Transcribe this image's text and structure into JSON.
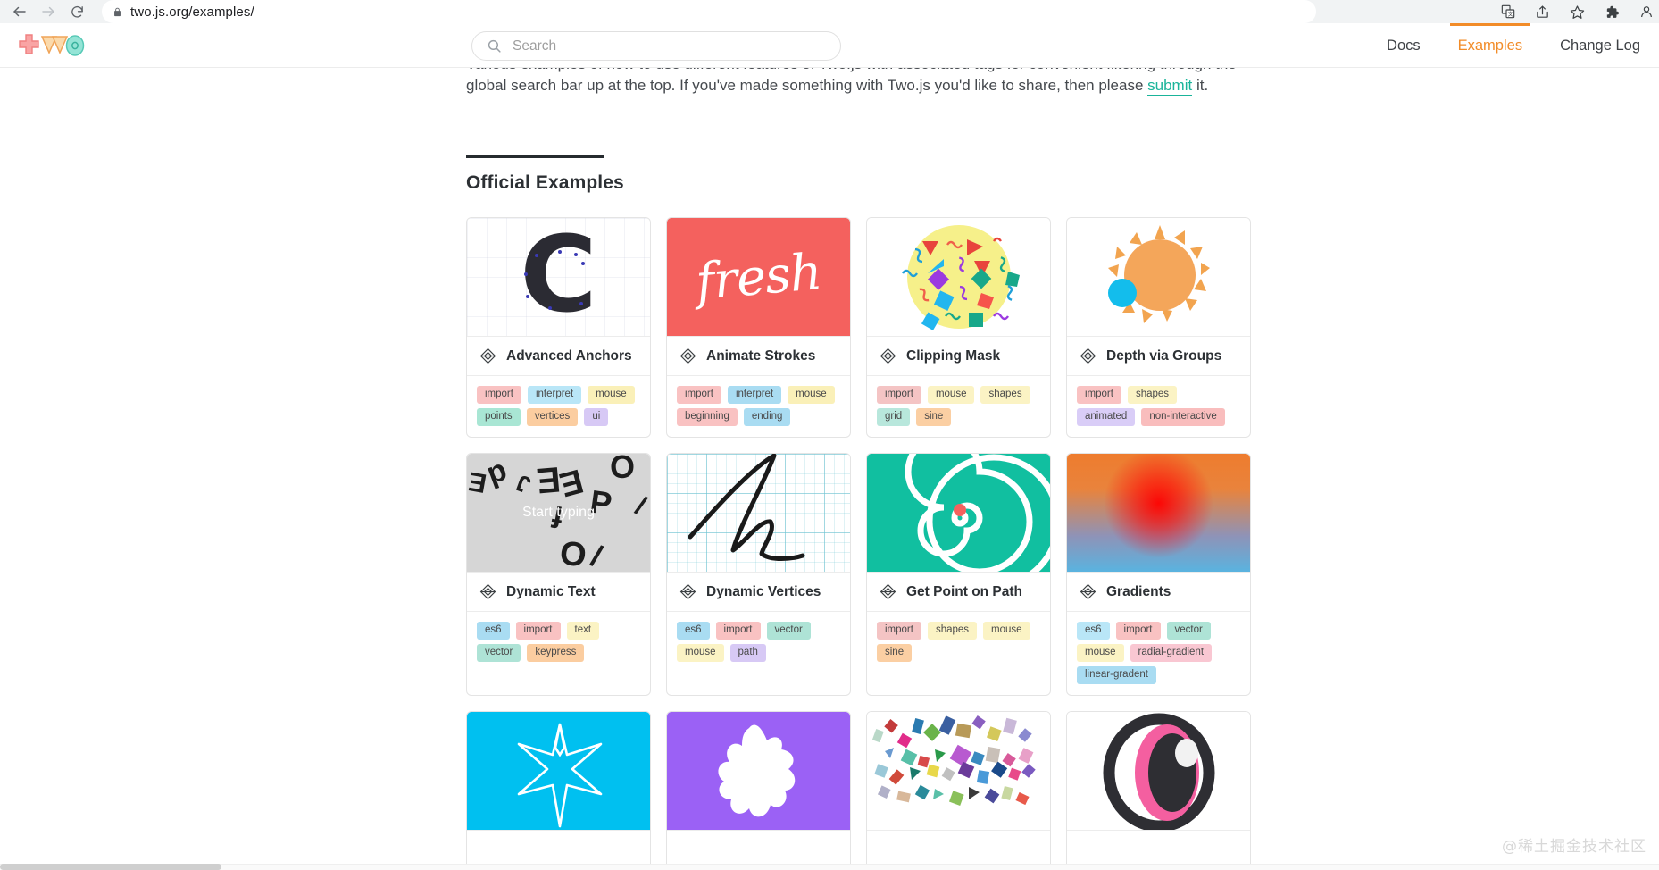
{
  "browser": {
    "url": "two.js.org/examples/",
    "back_label": "Back",
    "forward_label": "Forward",
    "reload_label": "Reload",
    "lock_label": "View site information",
    "actions": [
      "translate-icon",
      "share-icon",
      "bookmark-star-icon",
      "extensions-puzzle-icon"
    ]
  },
  "header": {
    "logo_alt": "Two.js",
    "search": {
      "placeholder": "Search",
      "value": ""
    },
    "nav": [
      {
        "label": "Docs",
        "active": false
      },
      {
        "label": "Examples",
        "active": true
      },
      {
        "label": "Change Log",
        "active": false
      }
    ],
    "accent_color": "#f28c28"
  },
  "main": {
    "intro_line1": "Various examples of how to use different features of Two.js with associated tags for convenient filtering through the global",
    "intro_line2_pre": "search bar up at the top. If you've made something with Two.js you'd like to share, then please ",
    "intro_link": "submit",
    "intro_line2_post": " it.",
    "link_color": "#1ab49a",
    "section_title": "Official Examples",
    "cards": [
      {
        "title": "Advanced Anchors",
        "preview": "letter-c-on-grid",
        "tags": [
          {
            "label": "import",
            "color": "#f9c2c2"
          },
          {
            "label": "interpret",
            "color": "#b9e6f7"
          },
          {
            "label": "mouse",
            "color": "#faf0b8"
          },
          {
            "label": "points",
            "color": "#a9e6d4"
          },
          {
            "label": "vertices",
            "color": "#fbcda0"
          },
          {
            "label": "ui",
            "color": "#d7c9f5"
          }
        ]
      },
      {
        "title": "Animate Strokes",
        "preview": "fresh-script",
        "preview_text": "fresh",
        "preview_bg": "#f4615e",
        "tags": [
          {
            "label": "import",
            "color": "#f9c2c2"
          },
          {
            "label": "interpret",
            "color": "#a9dcf2"
          },
          {
            "label": "mouse",
            "color": "#faf0b8"
          },
          {
            "label": "beginning",
            "color": "#f9c2c2"
          },
          {
            "label": "ending",
            "color": "#a9dcf2"
          }
        ]
      },
      {
        "title": "Clipping Mask",
        "preview": "yellow-circle-confetti",
        "tags": [
          {
            "label": "import",
            "color": "#f4c4c4"
          },
          {
            "label": "mouse",
            "color": "#fbf3c4"
          },
          {
            "label": "shapes",
            "color": "#fbf3c4"
          },
          {
            "label": "grid",
            "color": "#b8e7dc"
          },
          {
            "label": "sine",
            "color": "#fbcfa3"
          }
        ]
      },
      {
        "title": "Depth via Groups",
        "preview": "orange-sun",
        "tags": [
          {
            "label": "import",
            "color": "#f9c2c2"
          },
          {
            "label": "shapes",
            "color": "#fbf3c4"
          },
          {
            "label": "animated",
            "color": "#d9cdf7"
          },
          {
            "label": "non-interactive",
            "color": "#f9bdbd"
          }
        ]
      },
      {
        "title": "Dynamic Text",
        "preview": "scattered-letters",
        "preview_prompt": "Start typing",
        "tags": [
          {
            "label": "es6",
            "color": "#a9dcf2"
          },
          {
            "label": "import",
            "color": "#f9c2c2"
          },
          {
            "label": "text",
            "color": "#fbf3c4"
          },
          {
            "label": "vector",
            "color": "#aee3d6"
          },
          {
            "label": "keypress",
            "color": "#fbcda0"
          }
        ]
      },
      {
        "title": "Dynamic Vertices",
        "preview": "graph-paper-stroke",
        "tags": [
          {
            "label": "es6",
            "color": "#a9dcf2"
          },
          {
            "label": "import",
            "color": "#f9c2c2"
          },
          {
            "label": "vector",
            "color": "#aee3d6"
          },
          {
            "label": "mouse",
            "color": "#fbf3c4"
          },
          {
            "label": "path",
            "color": "#d7c9f5"
          }
        ]
      },
      {
        "title": "Get Point on Path",
        "preview": "teal-spiral",
        "tags": [
          {
            "label": "import",
            "color": "#f4c4c4"
          },
          {
            "label": "shapes",
            "color": "#fbf3c4"
          },
          {
            "label": "mouse",
            "color": "#fbf3c4"
          },
          {
            "label": "sine",
            "color": "#fbcfa3"
          }
        ]
      },
      {
        "title": "Gradients",
        "preview": "radial-linear-gradient",
        "tags": [
          {
            "label": "es6",
            "color": "#b9e6f7"
          },
          {
            "label": "import",
            "color": "#f9c2c2"
          },
          {
            "label": "vector",
            "color": "#aee3d6"
          },
          {
            "label": "mouse",
            "color": "#fbf3c4"
          },
          {
            "label": "radial-gradient",
            "color": "#f9c7d2"
          },
          {
            "label": "linear-gradent",
            "color": "#a9dcf2"
          }
        ]
      },
      {
        "title": "",
        "preview": "cyan-star",
        "tags": []
      },
      {
        "title": "",
        "preview": "purple-splat",
        "tags": []
      },
      {
        "title": "",
        "preview": "confetti-shapes",
        "tags": []
      },
      {
        "title": "",
        "preview": "pink-eye",
        "tags": []
      }
    ]
  },
  "watermark": "@稀土掘金技术社区"
}
